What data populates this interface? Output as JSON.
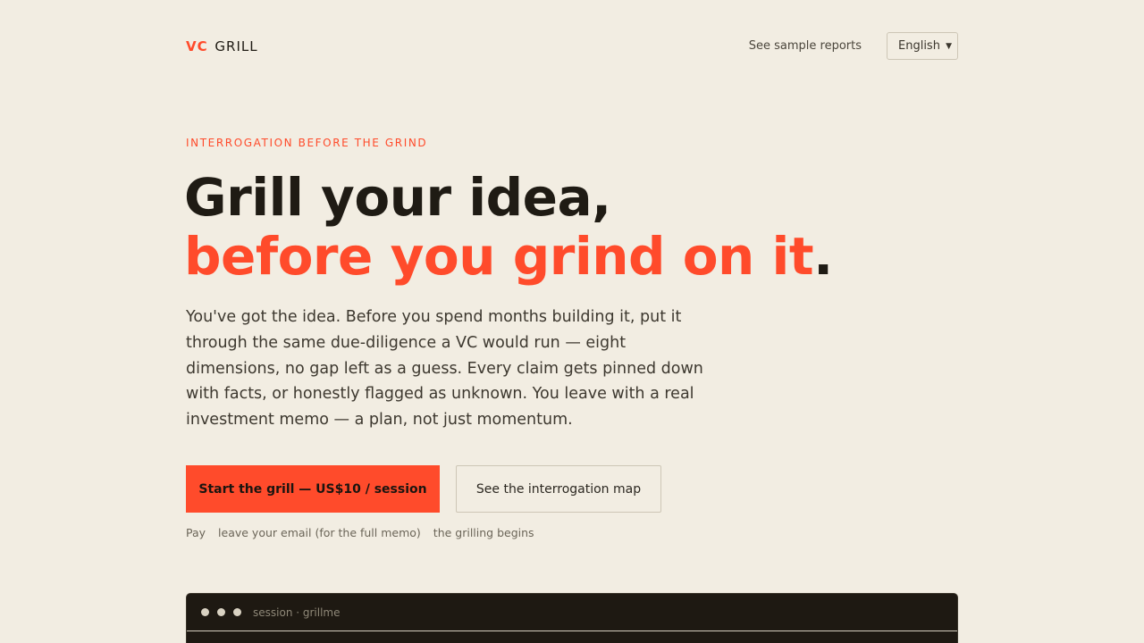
{
  "header": {
    "logo_vc": "VC",
    "logo_grill": "GRILL",
    "nav_link": "See sample reports",
    "language": "English"
  },
  "hero": {
    "eyebrow": "INTERROGATION BEFORE THE GRIND",
    "headline_line1": "Grill your idea,",
    "headline_line2": "before you grind on it",
    "headline_dot": ".",
    "lede": "You've got the idea. Before you spend months building it, put it through the same due-diligence a VC would run — eight dimensions, no gap left as a guess. Every claim gets pinned down with facts, or honestly flagged as unknown. You leave with a real investment memo — a plan, not just momentum."
  },
  "cta": {
    "primary_label": "Start the grill — US$10 / session",
    "secondary_label": "See the interrogation map"
  },
  "steps": [
    "Pay",
    "leave your email (for the full memo)",
    "the grilling begins"
  ],
  "terminal": {
    "title": "session · grillme"
  },
  "colors": {
    "accent": "#ff4b2b",
    "background": "#f2ede2",
    "ink": "#1f1b14",
    "terminal_bg": "#1e1912"
  }
}
